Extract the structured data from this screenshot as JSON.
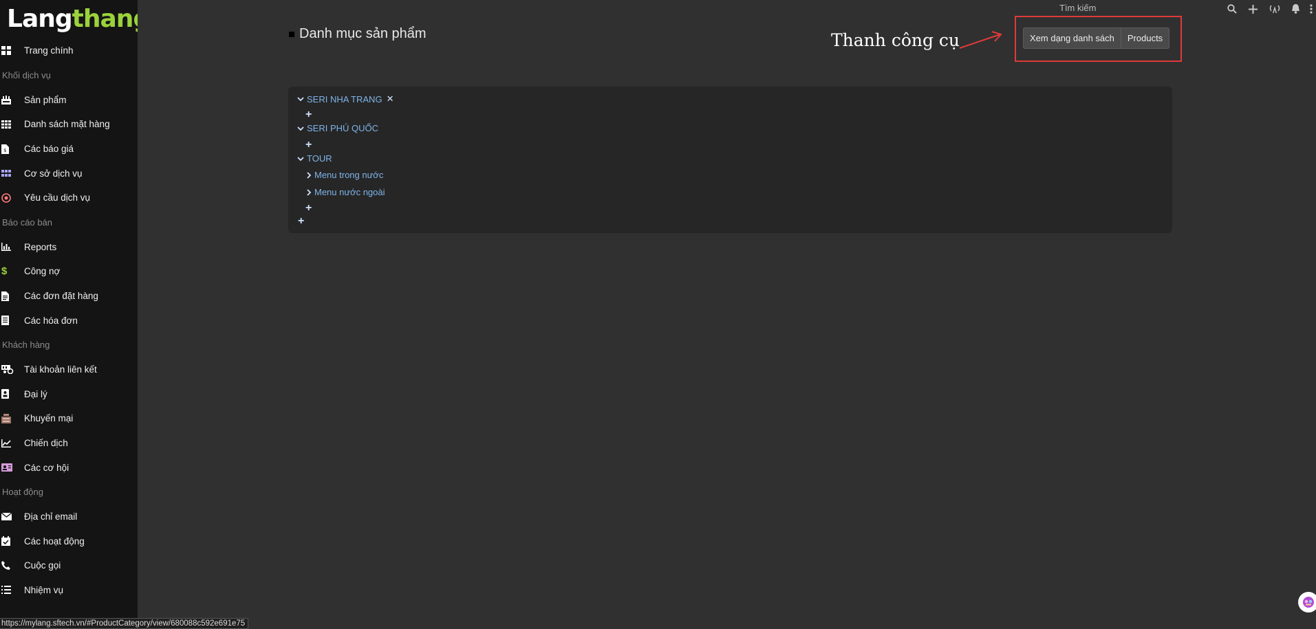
{
  "logo": {
    "part1": "Lang",
    "part2": "thang"
  },
  "sidebar": {
    "items": [
      {
        "type": "item",
        "label": "Trang chính",
        "icon": "dashboard-icon"
      },
      {
        "type": "section",
        "label": "Khối dịch vụ"
      },
      {
        "type": "item",
        "label": "Sản phẩm",
        "icon": "products-icon"
      },
      {
        "type": "item",
        "label": "Danh sách mặt hàng",
        "icon": "grid-icon"
      },
      {
        "type": "item",
        "label": "Các báo giá",
        "icon": "quote-icon"
      },
      {
        "type": "item",
        "label": "Cơ sở dịch vụ",
        "icon": "dots-grid-icon"
      },
      {
        "type": "item",
        "label": "Yêu cầu dịch vụ",
        "icon": "target-icon"
      },
      {
        "type": "section",
        "label": "Báo cáo bán"
      },
      {
        "type": "item",
        "label": "Reports",
        "icon": "bar-chart-icon"
      },
      {
        "type": "item",
        "label": "Công nợ",
        "icon": "dollar-icon"
      },
      {
        "type": "item",
        "label": "Các đơn đặt hàng",
        "icon": "order-icon"
      },
      {
        "type": "item",
        "label": "Các hóa đơn",
        "icon": "invoice-icon"
      },
      {
        "type": "section",
        "label": "Khách hàng"
      },
      {
        "type": "item",
        "label": "Tài khoản liên kết",
        "icon": "linked-account-icon"
      },
      {
        "type": "item",
        "label": "Đại lý",
        "icon": "agent-icon"
      },
      {
        "type": "item",
        "label": "Khuyến mại",
        "icon": "promotion-icon"
      },
      {
        "type": "item",
        "label": "Chiến dịch",
        "icon": "line-chart-icon"
      },
      {
        "type": "item",
        "label": "Các cơ hội",
        "icon": "id-card-icon"
      },
      {
        "type": "section",
        "label": "Hoạt động"
      },
      {
        "type": "item",
        "label": "Địa chỉ email",
        "icon": "envelope-icon"
      },
      {
        "type": "item",
        "label": "Các hoạt động",
        "icon": "calendar-check-icon"
      },
      {
        "type": "item",
        "label": "Cuộc gọi",
        "icon": "phone-icon"
      },
      {
        "type": "item",
        "label": "Nhiệm vụ",
        "icon": "task-list-icon"
      }
    ]
  },
  "topbar": {
    "search_label": "Tìm kiếm",
    "icons": [
      "search-icon",
      "plus-icon",
      "broadcast-icon",
      "bell-icon",
      "kebab-menu-icon"
    ]
  },
  "main": {
    "title": "Danh mục sản phẩm",
    "annotation": "Thanh công cụ",
    "toolbar": {
      "list_view_label": "Xem dạng danh sách",
      "products_label": "Products"
    },
    "tree": {
      "nodes": [
        {
          "label": "SERI NHA TRANG",
          "expanded": true,
          "removable": true
        },
        {
          "label": "SERI PHÚ QUỐC",
          "expanded": true
        },
        {
          "label": "TOUR",
          "expanded": true,
          "children": [
            "Menu trong nước",
            "Menu nước ngoài"
          ]
        }
      ]
    }
  },
  "status_bar": {
    "url": "https://mylang.sftech.vn/#ProductCategory/view/680088c592e691e75"
  },
  "colors": {
    "background": "#303030",
    "sidebar": "#141414",
    "panel": "#262626",
    "tree_link": "#7fb4e8",
    "logo_accent": "#9bd23b",
    "highlight_box": "#e03a3a"
  }
}
